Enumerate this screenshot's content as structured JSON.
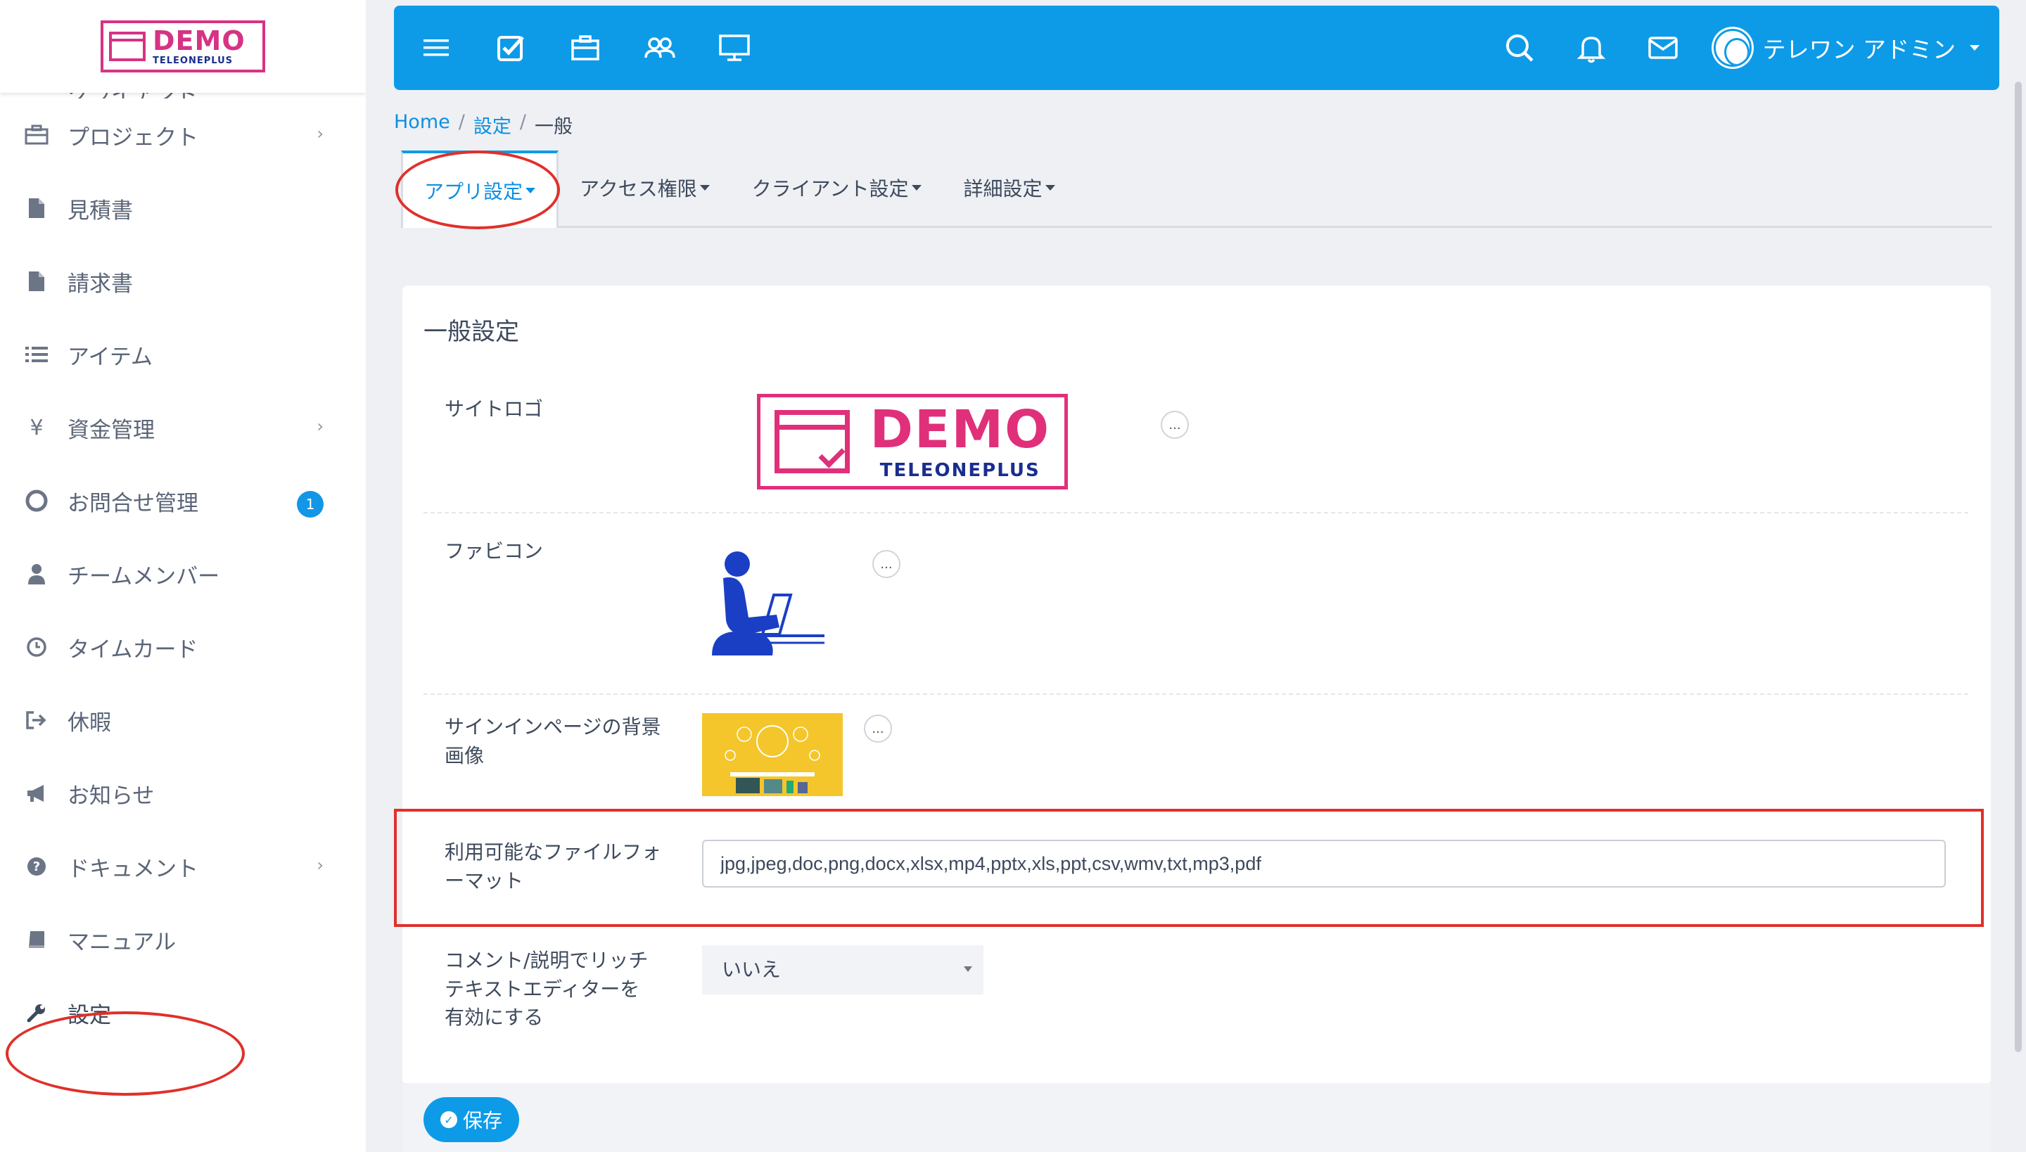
{
  "brand": {
    "logo_text": "DEMO",
    "logo_subtext": "TELEONEPLUS"
  },
  "sidebar": {
    "items": [
      {
        "label": "クライアント",
        "icon": "users-icon"
      },
      {
        "label": "プロジェクト",
        "icon": "briefcase-icon",
        "has_submenu": true
      },
      {
        "label": "見積書",
        "icon": "file-icon"
      },
      {
        "label": "請求書",
        "icon": "file-icon"
      },
      {
        "label": "アイテム",
        "icon": "list-icon"
      },
      {
        "label": "資金管理",
        "icon": "yen-icon",
        "has_submenu": true
      },
      {
        "label": "お問合せ管理",
        "icon": "lifebuoy-icon",
        "badge": "1"
      },
      {
        "label": "チームメンバー",
        "icon": "user-icon"
      },
      {
        "label": "タイムカード",
        "icon": "clock-icon"
      },
      {
        "label": "休暇",
        "icon": "signout-icon"
      },
      {
        "label": "お知らせ",
        "icon": "megaphone-icon"
      },
      {
        "label": "ドキュメント",
        "icon": "question-icon",
        "has_submenu": true
      },
      {
        "label": "マニュアル",
        "icon": "book-icon"
      },
      {
        "label": "設定",
        "icon": "wrench-icon"
      }
    ],
    "chevron": "›"
  },
  "topbar": {
    "user_name": "テレワン アドミン",
    "accent": "#0d9be8"
  },
  "breadcrumb": {
    "home": "Home",
    "settings": "設定",
    "current": "一般",
    "sep": "/"
  },
  "tabs": [
    {
      "label": "アプリ設定"
    },
    {
      "label": "アクセス権限"
    },
    {
      "label": "クライアント設定"
    },
    {
      "label": "詳細設定"
    }
  ],
  "panel": {
    "title": "一般設定",
    "site_logo_label": "サイトロゴ",
    "favicon_label": "ファビコン",
    "signin_bg_label": "サインインページの背景画像",
    "file_formats_label": "利用可能なファイルフォーマット",
    "file_formats_value": "jpg,jpeg,doc,png,docx,xlsx,mp4,pptx,xls,ppt,csv,wmv,txt,mp3,pdf",
    "rich_text_label": "コメント/説明でリッチテキストエディターを有効にする",
    "rich_text_value": "いいえ",
    "dots": "..."
  },
  "save_label": "保存",
  "colors": {
    "highlight": "#e0302a",
    "brand_pink": "#e0307a",
    "brand_navy": "#1a2d8f"
  }
}
